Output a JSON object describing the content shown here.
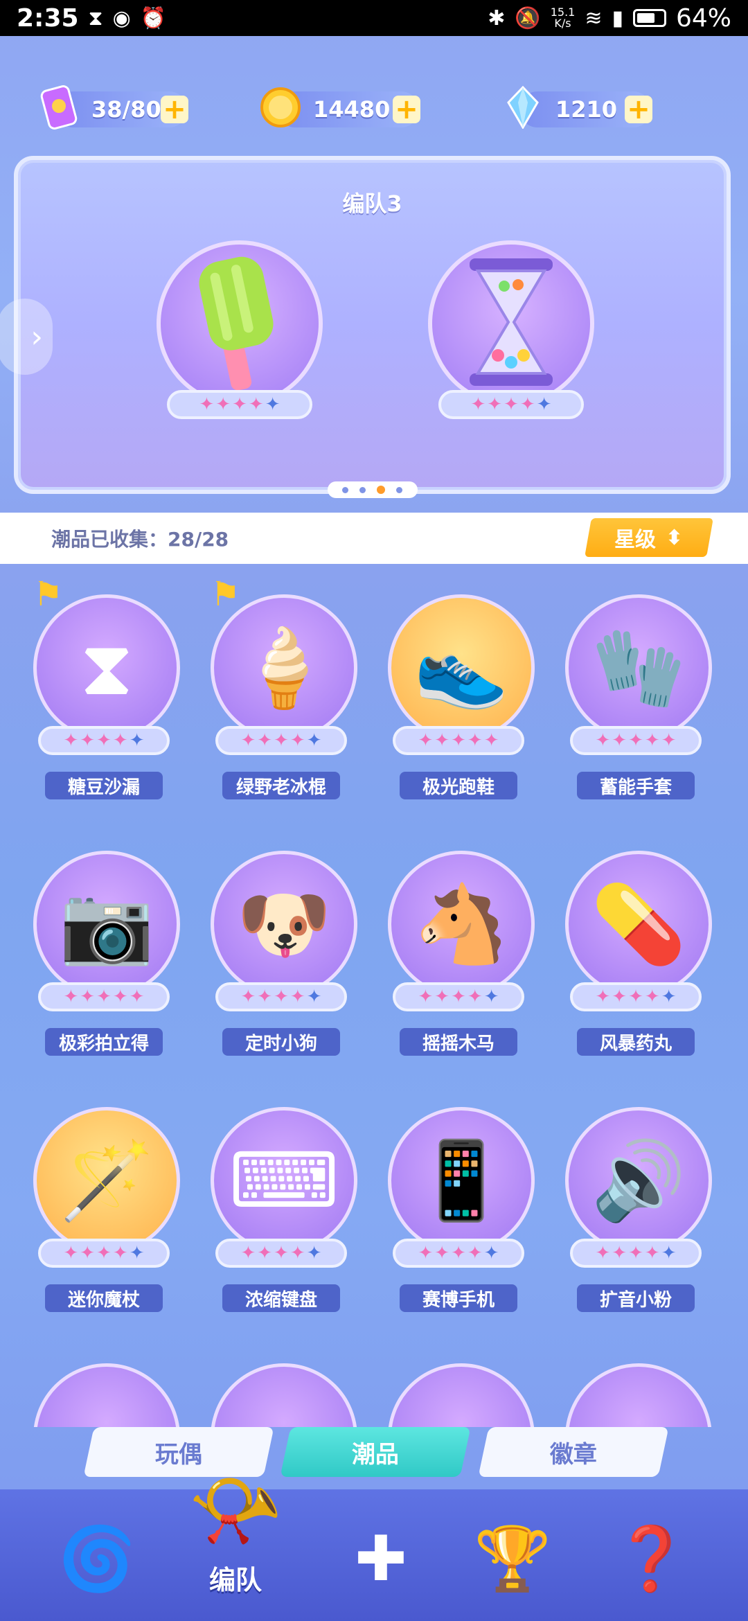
{
  "status_bar": {
    "time": "2:35",
    "net_speed": "15.1",
    "net_unit": "K/s",
    "battery": "64%"
  },
  "resources": {
    "energy": {
      "value": "38/80",
      "icon": "energy-card-icon"
    },
    "coins": {
      "value": "14480",
      "icon": "coin-icon"
    },
    "gems": {
      "value": "1210",
      "icon": "crystal-icon"
    }
  },
  "team": {
    "title": "编队3",
    "slots": [
      {
        "item": "popsicle",
        "stars_pink": 4,
        "stars_blue": 1
      },
      {
        "item": "hourglass",
        "stars_pink": 4,
        "stars_blue": 1
      }
    ],
    "page_indicator": {
      "count": 4,
      "active": 2
    }
  },
  "collection": {
    "label": "潮品已收集：28/28",
    "sort_label": "星级"
  },
  "items": [
    {
      "name": "糖豆沙漏",
      "stars_pink": 4,
      "stars_blue": 1,
      "flag": true
    },
    {
      "name": "绿野老冰棍",
      "stars_pink": 4,
      "stars_blue": 1,
      "flag": true
    },
    {
      "name": "极光跑鞋",
      "stars_pink": 5,
      "stars_blue": 0,
      "flag": false
    },
    {
      "name": "蓄能手套",
      "stars_pink": 5,
      "stars_blue": 0,
      "flag": false
    },
    {
      "name": "极彩拍立得",
      "stars_pink": 5,
      "stars_blue": 0,
      "flag": false
    },
    {
      "name": "定时小狗",
      "stars_pink": 4,
      "stars_blue": 1,
      "flag": false
    },
    {
      "name": "摇摇木马",
      "stars_pink": 4,
      "stars_blue": 1,
      "flag": false
    },
    {
      "name": "风暴药丸",
      "stars_pink": 4,
      "stars_blue": 1,
      "flag": false
    },
    {
      "name": "迷你魔杖",
      "stars_pink": 4,
      "stars_blue": 1,
      "flag": false
    },
    {
      "name": "浓缩键盘",
      "stars_pink": 4,
      "stars_blue": 1,
      "flag": false
    },
    {
      "name": "赛博手机",
      "stars_pink": 4,
      "stars_blue": 1,
      "flag": false
    },
    {
      "name": "扩音小粉",
      "stars_pink": 4,
      "stars_blue": 1,
      "flag": false
    }
  ],
  "tabs": [
    {
      "label": "玩偶",
      "active": false
    },
    {
      "label": "潮品",
      "active": true
    },
    {
      "label": "徽章",
      "active": false
    }
  ],
  "bottom_nav": {
    "active_label": "编队"
  }
}
